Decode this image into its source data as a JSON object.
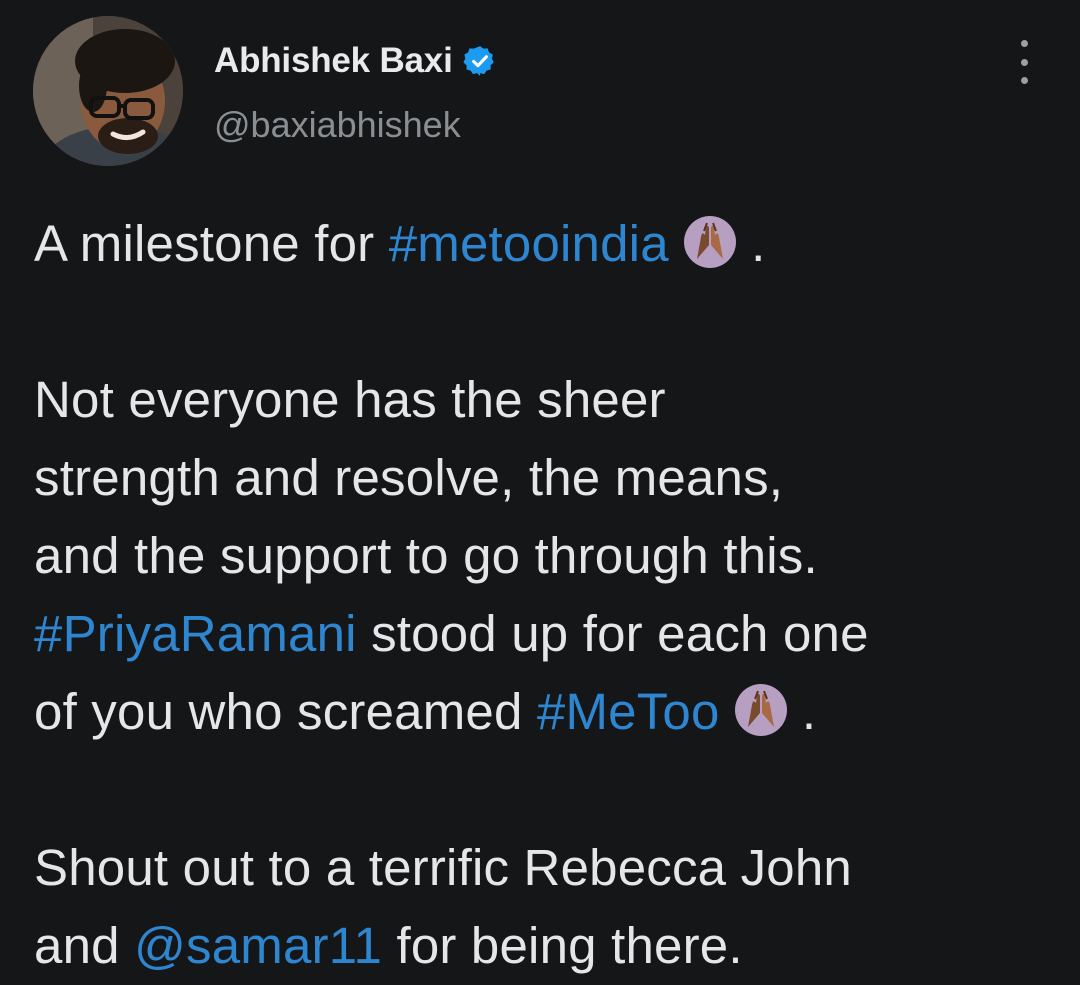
{
  "author": {
    "display_name": "Abhishek Baxi",
    "handle": "@baxiabhishek",
    "verified": true,
    "avatar": "avatar-photo"
  },
  "menu": {
    "icon": "more-vertical-icon"
  },
  "tweet": {
    "line1_text": "A milestone for ",
    "line1_hashtag": "#metooindia",
    "line1_end": " .",
    "line1_emoji": "raising-hands-emoji",
    "line2": "Not everyone has the sheer",
    "line3": "strength and resolve, the means,",
    "line4": "and the support to go through this.",
    "line5_hashtag": "#PriyaRamani",
    "line5_text": " stood up for each one",
    "line6_text": "of you who screamed ",
    "line6_hashtag": "#MeToo",
    "line6_end": " .",
    "line6_emoji": "raising-hands-emoji",
    "line7": "Shout out to a terrific Rebecca John",
    "line8_text": "and ",
    "line8_mention": "@samar11",
    "line8_end": " for being there."
  },
  "colors": {
    "background": "#151618",
    "text": "#e4e6e8",
    "secondary": "#8a8f94",
    "link": "#2e86d0",
    "verified": "#1d9bf0"
  }
}
